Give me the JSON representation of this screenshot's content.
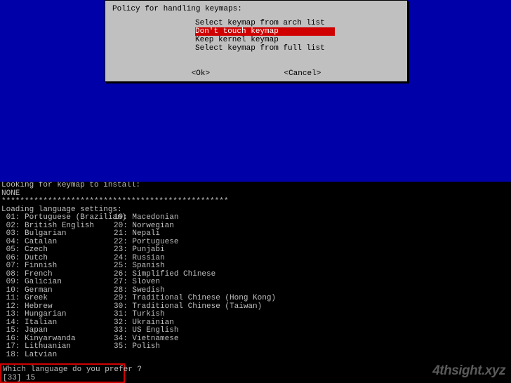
{
  "dialog": {
    "title": "Policy for handling keymaps:",
    "items": [
      "Select keymap from arch list",
      "Don't touch keymap",
      "Keep kernel keymap",
      "Select keymap from full list"
    ],
    "selected_index": 1,
    "ok_label": "<Ok>",
    "cancel_label": "<Cancel>"
  },
  "terminal": {
    "line1": "Looking for keymap to install:",
    "line2": "NONE",
    "stars": "*************************************************",
    "line4": "Loading language settings:"
  },
  "languages_col1": [
    " 01: Portuguese (Brazilian)",
    " 02: British English",
    " 03: Bulgarian",
    " 04: Catalan",
    " 05: Czech",
    " 06: Dutch",
    " 07: Finnish",
    " 08: French",
    " 09: Galician",
    " 10: German",
    " 11: Greek",
    " 12: Hebrew",
    " 13: Hungarian",
    " 14: Italian",
    " 15: Japan",
    " 16: Kinyarwanda",
    " 17: Lithuanian",
    " 18: Latvian"
  ],
  "languages_col2": [
    "19: Macedonian",
    "20: Norwegian",
    "21: Nepali",
    "22: Portuguese",
    "23: Punjabi",
    "24: Russian",
    "25: Spanish",
    "26: Simplified Chinese",
    "27: Sloven",
    "28: Swedish",
    "29: Traditional Chinese (Hong Kong)",
    "30: Traditional Chinese (Taiwan)",
    "31: Turkish",
    "32: Ukrainian",
    "33: US English",
    "34: Vietnamese",
    "35: Polish",
    ""
  ],
  "prompt": {
    "question": "Which language do you prefer ?",
    "input": "[33] 15"
  },
  "watermark": "4thsight.xyz"
}
